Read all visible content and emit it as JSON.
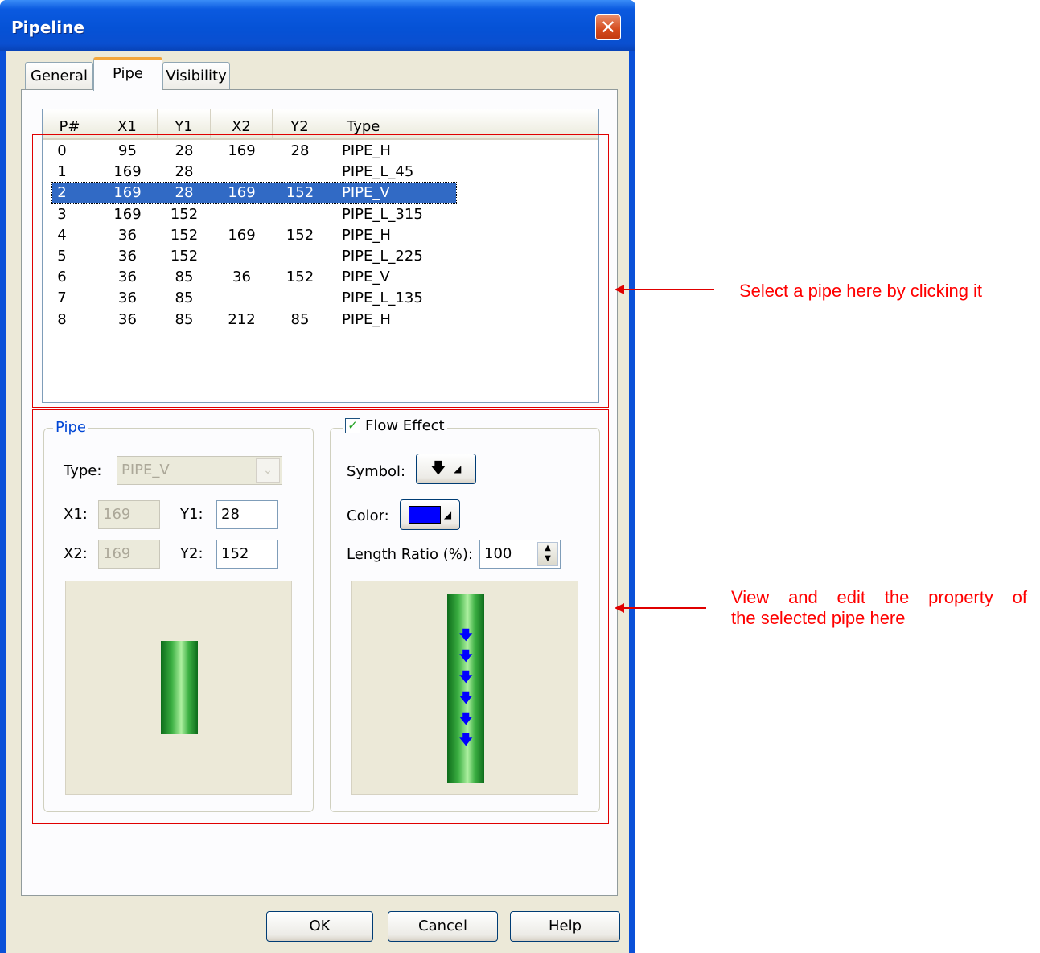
{
  "window": {
    "title": "Pipeline",
    "close_icon": "close-x-icon"
  },
  "tabs": [
    {
      "label": "General",
      "active": false
    },
    {
      "label": "Pipe",
      "active": true
    },
    {
      "label": "Visibility",
      "active": false
    }
  ],
  "pipe_list": {
    "columns": [
      "P#",
      "X1",
      "Y1",
      "X2",
      "Y2",
      "Type"
    ],
    "rows": [
      {
        "p": "0",
        "x1": "95",
        "y1": "28",
        "x2": "169",
        "y2": "28",
        "type": "PIPE_H"
      },
      {
        "p": "1",
        "x1": "169",
        "y1": "28",
        "x2": "",
        "y2": "",
        "type": "PIPE_L_45"
      },
      {
        "p": "2",
        "x1": "169",
        "y1": "28",
        "x2": "169",
        "y2": "152",
        "type": "PIPE_V"
      },
      {
        "p": "3",
        "x1": "169",
        "y1": "152",
        "x2": "",
        "y2": "",
        "type": "PIPE_L_315"
      },
      {
        "p": "4",
        "x1": "36",
        "y1": "152",
        "x2": "169",
        "y2": "152",
        "type": "PIPE_H"
      },
      {
        "p": "5",
        "x1": "36",
        "y1": "152",
        "x2": "",
        "y2": "",
        "type": "PIPE_L_225"
      },
      {
        "p": "6",
        "x1": "36",
        "y1": "85",
        "x2": "36",
        "y2": "152",
        "type": "PIPE_V"
      },
      {
        "p": "7",
        "x1": "36",
        "y1": "85",
        "x2": "",
        "y2": "",
        "type": "PIPE_L_135"
      },
      {
        "p": "8",
        "x1": "36",
        "y1": "85",
        "x2": "212",
        "y2": "85",
        "type": "PIPE_H"
      }
    ],
    "selected_index": 2
  },
  "pipe_group": {
    "legend": "Pipe",
    "type_label": "Type:",
    "type_value": "PIPE_V",
    "x1_label": "X1:",
    "x1_value": "169",
    "y1_label": "Y1:",
    "y1_value": "28",
    "x2_label": "X2:",
    "x2_value": "169",
    "y2_label": "Y2:",
    "y2_value": "152"
  },
  "flow_group": {
    "legend": "Flow Effect",
    "enabled": true,
    "symbol_label": "Symbol:",
    "symbol_icon": "down-arrow-icon",
    "color_label": "Color:",
    "color_value": "#0000ff",
    "length_label": "Length Ratio (%):",
    "length_value": "100"
  },
  "buttons": {
    "ok": "OK",
    "cancel": "Cancel",
    "help": "Help"
  },
  "annotations": {
    "list_note": "Select a pipe here by clicking it",
    "edit_note_line1": "View and edit the property of",
    "edit_note_line2": "the selected pipe here"
  },
  "colors": {
    "accent_red": "#ff0000",
    "pipe_green": "#3cb043",
    "selection": "#316ac5"
  }
}
